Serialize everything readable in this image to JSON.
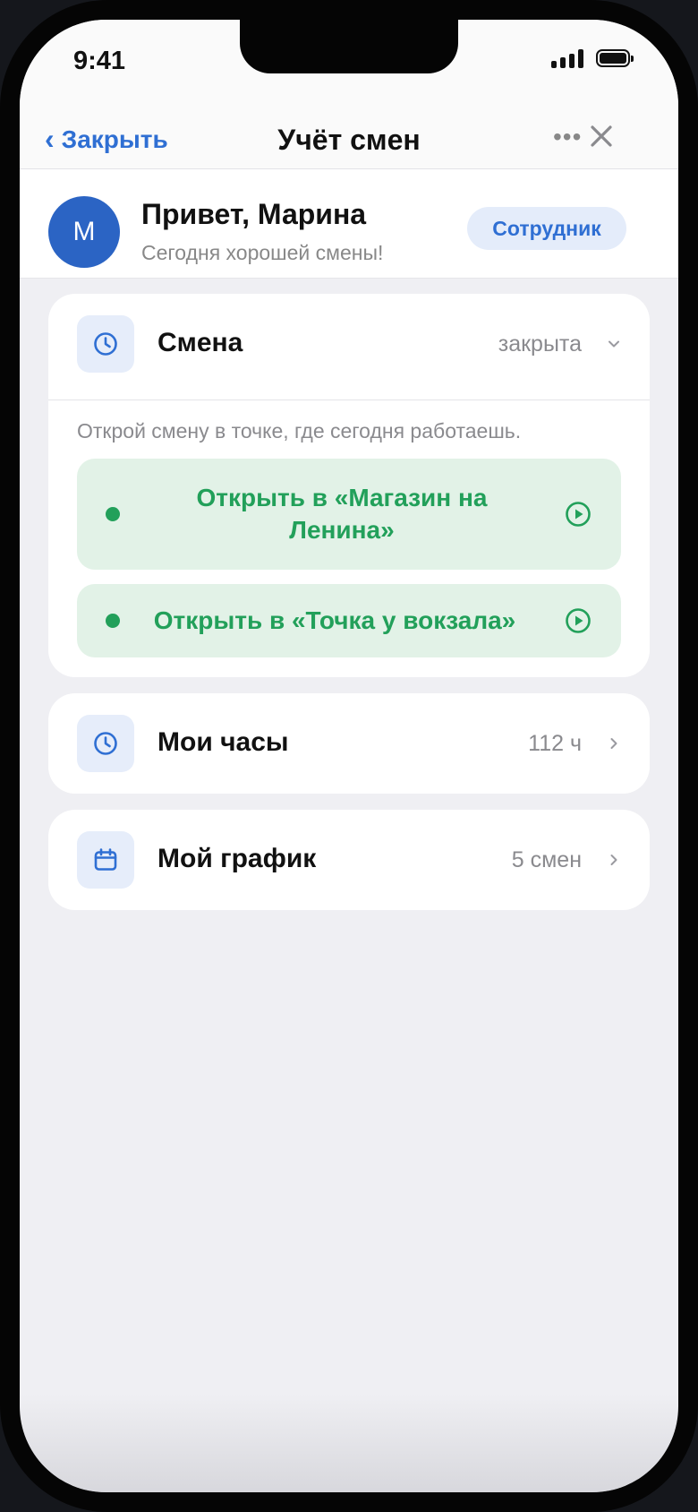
{
  "status_bar": {
    "time": "9:41"
  },
  "header": {
    "back_label": "Закрыть",
    "title": "Учёт смен",
    "more_label": "•••"
  },
  "profile": {
    "avatar_letter": "M",
    "greeting": "Привет, Марина",
    "subtitle": "Сегодня хорошей смены!",
    "role": "Сотрудник"
  },
  "shift": {
    "title": "Смена",
    "status": "закрыта",
    "hint": "Открой смену в точке, где сегодня работаешь.",
    "buttons": [
      {
        "label_line1": "Открыть в «Магазин на",
        "label_line2": "Ленина»"
      },
      {
        "label": "Открыть в «Точка у вокзала»"
      }
    ]
  },
  "hours": {
    "title": "Мои часы",
    "value": "112 ч"
  },
  "schedule": {
    "title": "Мой график",
    "value": "5 смен"
  },
  "colors": {
    "accent_blue": "#2f6fd3",
    "accent_green": "#22a05a",
    "background": "#efeff3"
  },
  "icons": {
    "shift": "clock-icon",
    "hours": "clock-icon",
    "schedule": "calendar-icon",
    "open": "play-circle-icon"
  }
}
